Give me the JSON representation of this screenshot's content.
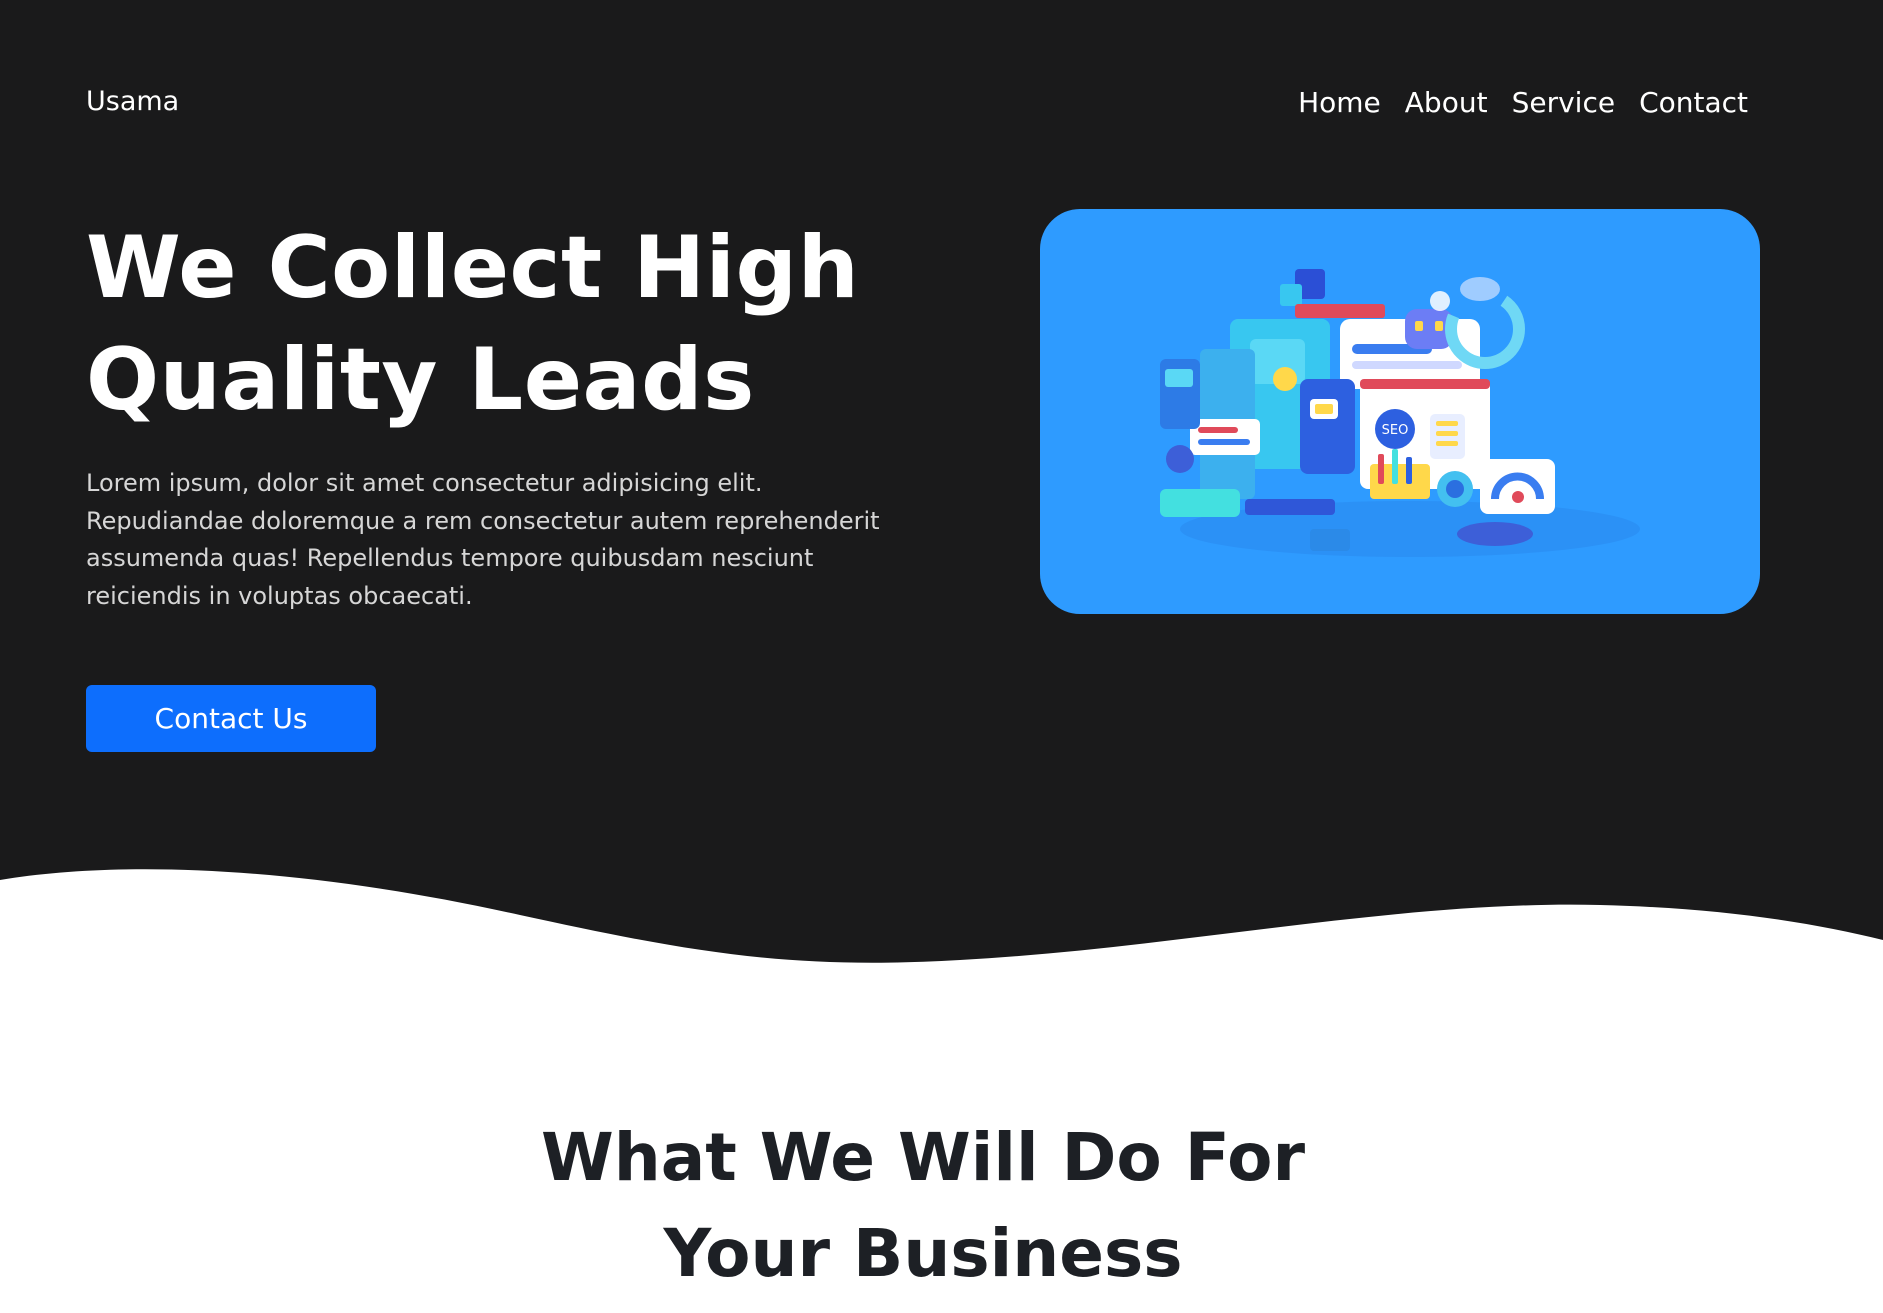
{
  "nav": {
    "logo": "Usama",
    "links": [
      {
        "label": "Home"
      },
      {
        "label": "About"
      },
      {
        "label": "Service"
      },
      {
        "label": "Contact"
      }
    ]
  },
  "hero": {
    "title_line1": "We Collect High",
    "title_line2": "Quality Leads",
    "description": "Lorem ipsum, dolor sit amet consectetur adipisicing elit. Repudiandae doloremque a rem consectetur autem reprehenderit assumenda quas! Repellendus tempore quibusdam nesciunt reiciendis in voluptas obcaecati.",
    "cta_label": "Contact Us",
    "image_badge_text": "SEO"
  },
  "section": {
    "title_line1": "What We Will Do For",
    "title_line2": "Your Business"
  },
  "colors": {
    "hero_bg": "#1a1a1b",
    "accent": "#0d6efd",
    "image_bg": "#2e9bff",
    "heading_dark": "#1d2025"
  }
}
